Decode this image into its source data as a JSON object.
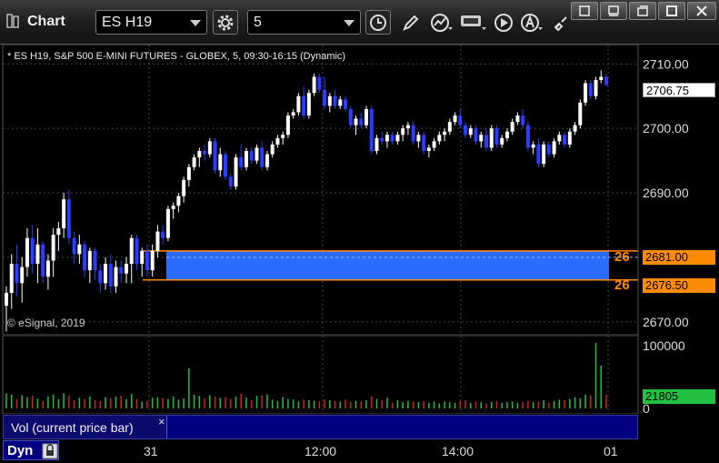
{
  "window": {
    "title": "Chart",
    "symbol": "ES H19",
    "interval": "5"
  },
  "chart": {
    "header": "* ES H19, S&P 500 E-MINI FUTURES - GLOBEX, 5, 09:30-16:15 (Dynamic)",
    "copyright": "© eSignal, 2019",
    "price_ticks": [
      "2710.00",
      "2700.00",
      "2690.00",
      "2680.00",
      "2670.00"
    ],
    "last_price": "2706.75",
    "zone_high": "2681.00",
    "zone_low": "2676.50",
    "zone_high_label": "26",
    "zone_low_label": "26",
    "zone_color": "#2b6cff",
    "line_color": "#ff8c00"
  },
  "volume": {
    "ticks": [
      "100000",
      "0"
    ],
    "last_volume": "21805",
    "study_label": "Vol (current price bar)",
    "close_symbol": "×"
  },
  "time_axis": {
    "labels": [
      "31",
      "12:00",
      "14:00",
      "01"
    ],
    "dyn_label": "Dyn"
  },
  "chart_data": [
    {
      "type": "candlestick",
      "title": "* ES H19, S&P 500 E-MINI FUTURES - GLOBEX, 5, 09:30-16:15 (Dynamic)",
      "ylim": [
        2668,
        2713
      ],
      "yticks": [
        2670,
        2680,
        2690,
        2700,
        2710
      ],
      "xticks": [
        "31",
        "12:00",
        "14:00",
        "01"
      ],
      "bars": [
        [
          2672.5,
          2675.5,
          2668.5,
          2674.5
        ],
        [
          2674.5,
          2680.5,
          2672.0,
          2679.0
        ],
        [
          2679.0,
          2682.0,
          2674.0,
          2676.0
        ],
        [
          2676.0,
          2680.0,
          2673.0,
          2678.5
        ],
        [
          2678.5,
          2684.5,
          2677.0,
          2683.0
        ],
        [
          2683.0,
          2685.0,
          2677.5,
          2679.0
        ],
        [
          2679.0,
          2684.5,
          2676.0,
          2682.0
        ],
        [
          2682.0,
          2682.5,
          2676.0,
          2677.0
        ],
        [
          2677.0,
          2680.5,
          2675.0,
          2679.5
        ],
        [
          2679.5,
          2684.5,
          2677.0,
          2683.5
        ],
        [
          2683.5,
          2685.5,
          2681.0,
          2684.5
        ],
        [
          2684.5,
          2690.0,
          2683.0,
          2689.0
        ],
        [
          2689.0,
          2690.5,
          2682.0,
          2683.0
        ],
        [
          2683.0,
          2684.0,
          2679.0,
          2680.5
        ],
        [
          2680.5,
          2683.5,
          2679.0,
          2682.0
        ],
        [
          2682.0,
          2682.5,
          2677.0,
          2678.0
        ],
        [
          2678.0,
          2681.5,
          2676.0,
          2681.0
        ],
        [
          2681.0,
          2681.5,
          2676.5,
          2678.0
        ],
        [
          2678.0,
          2679.0,
          2674.5,
          2676.0
        ],
        [
          2676.0,
          2680.0,
          2675.0,
          2679.0
        ],
        [
          2679.0,
          2680.5,
          2674.5,
          2675.5
        ],
        [
          2675.5,
          2679.5,
          2674.5,
          2678.5
        ],
        [
          2678.5,
          2679.5,
          2676.0,
          2677.5
        ],
        [
          2677.5,
          2680.0,
          2676.0,
          2679.0
        ],
        [
          2679.0,
          2683.5,
          2676.0,
          2683.0
        ],
        [
          2683.0,
          2683.5,
          2678.0,
          2679.0
        ],
        [
          2679.0,
          2681.5,
          2677.0,
          2681.0
        ],
        [
          2681.0,
          2682.0,
          2677.0,
          2678.0
        ],
        [
          2678.0,
          2682.0,
          2677.0,
          2681.0
        ],
        [
          2681.0,
          2685.0,
          2680.0,
          2684.0
        ],
        [
          2684.0,
          2685.0,
          2682.0,
          2683.0
        ],
        [
          2683.0,
          2688.0,
          2682.5,
          2687.5
        ],
        [
          2687.5,
          2688.5,
          2686.0,
          2688.0
        ],
        [
          2688.0,
          2690.0,
          2687.0,
          2689.5
        ],
        [
          2689.5,
          2692.5,
          2688.5,
          2692.0
        ],
        [
          2692.0,
          2694.5,
          2691.0,
          2694.0
        ],
        [
          2694.0,
          2696.0,
          2693.5,
          2695.5
        ],
        [
          2695.5,
          2697.0,
          2694.0,
          2696.5
        ],
        [
          2696.5,
          2697.5,
          2695.0,
          2696.0
        ],
        [
          2696.0,
          2698.5,
          2695.5,
          2698.0
        ],
        [
          2698.0,
          2698.5,
          2693.0,
          2693.5
        ],
        [
          2693.5,
          2697.0,
          2692.5,
          2696.0
        ],
        [
          2696.0,
          2696.5,
          2692.0,
          2692.5
        ],
        [
          2692.5,
          2693.0,
          2690.5,
          2691.0
        ],
        [
          2691.0,
          2696.0,
          2690.5,
          2695.5
        ],
        [
          2695.5,
          2697.5,
          2693.5,
          2694.0
        ],
        [
          2694.0,
          2697.0,
          2693.5,
          2696.5
        ],
        [
          2696.5,
          2697.0,
          2694.5,
          2695.0
        ],
        [
          2695.0,
          2697.5,
          2694.5,
          2697.0
        ],
        [
          2697.0,
          2698.0,
          2693.5,
          2694.0
        ],
        [
          2694.0,
          2696.5,
          2693.5,
          2696.0
        ],
        [
          2696.0,
          2698.0,
          2695.5,
          2697.5
        ],
        [
          2697.5,
          2699.0,
          2697.0,
          2698.5
        ],
        [
          2698.5,
          2699.5,
          2697.5,
          2699.0
        ],
        [
          2699.0,
          2702.5,
          2698.5,
          2702.0
        ],
        [
          2702.0,
          2703.0,
          2701.5,
          2702.5
        ],
        [
          2702.5,
          2705.5,
          2702.0,
          2705.0
        ],
        [
          2705.0,
          2706.5,
          2701.5,
          2702.0
        ],
        [
          2702.0,
          2706.0,
          2701.5,
          2705.5
        ],
        [
          2705.5,
          2708.5,
          2705.0,
          2708.0
        ],
        [
          2708.0,
          2708.5,
          2705.5,
          2706.0
        ],
        [
          2706.0,
          2708.0,
          2703.0,
          2703.5
        ],
        [
          2703.5,
          2705.5,
          2702.5,
          2705.0
        ],
        [
          2705.0,
          2706.0,
          2703.0,
          2703.5
        ],
        [
          2703.5,
          2705.0,
          2703.0,
          2704.5
        ],
        [
          2704.5,
          2705.0,
          2702.5,
          2703.0
        ],
        [
          2703.0,
          2703.5,
          2700.0,
          2700.5
        ],
        [
          2700.5,
          2702.0,
          2699.0,
          2701.5
        ],
        [
          2701.5,
          2702.5,
          2700.0,
          2700.5
        ],
        [
          2700.5,
          2703.5,
          2700.0,
          2703.0
        ],
        [
          2703.0,
          2703.5,
          2696.0,
          2696.5
        ],
        [
          2696.5,
          2699.0,
          2696.0,
          2698.5
        ],
        [
          2698.5,
          2699.5,
          2697.5,
          2698.0
        ],
        [
          2698.0,
          2699.5,
          2697.0,
          2699.0
        ],
        [
          2699.0,
          2699.5,
          2697.5,
          2698.0
        ],
        [
          2698.0,
          2699.5,
          2697.5,
          2699.0
        ],
        [
          2699.0,
          2700.5,
          2698.0,
          2700.0
        ],
        [
          2700.0,
          2701.0,
          2699.0,
          2700.5
        ],
        [
          2700.5,
          2701.0,
          2697.5,
          2698.0
        ],
        [
          2698.0,
          2699.5,
          2697.0,
          2699.0
        ],
        [
          2699.0,
          2699.5,
          2696.0,
          2696.5
        ],
        [
          2696.5,
          2697.5,
          2695.5,
          2697.0
        ],
        [
          2697.0,
          2698.5,
          2696.5,
          2698.0
        ],
        [
          2698.0,
          2699.5,
          2697.5,
          2699.0
        ],
        [
          2699.0,
          2700.0,
          2698.0,
          2699.5
        ],
        [
          2699.5,
          2701.5,
          2699.0,
          2701.0
        ],
        [
          2701.0,
          2702.5,
          2700.5,
          2702.0
        ],
        [
          2702.0,
          2703.0,
          2700.0,
          2700.5
        ],
        [
          2700.5,
          2701.0,
          2698.5,
          2699.0
        ],
        [
          2699.0,
          2700.5,
          2698.5,
          2700.0
        ],
        [
          2700.0,
          2700.5,
          2697.5,
          2698.0
        ],
        [
          2698.0,
          2699.5,
          2697.0,
          2699.0
        ],
        [
          2699.0,
          2700.0,
          2696.5,
          2697.0
        ],
        [
          2697.0,
          2700.5,
          2696.5,
          2700.0
        ],
        [
          2700.0,
          2700.5,
          2697.0,
          2697.5
        ],
        [
          2697.5,
          2699.0,
          2697.0,
          2698.5
        ],
        [
          2698.5,
          2700.0,
          2698.0,
          2699.5
        ],
        [
          2699.5,
          2701.5,
          2699.0,
          2701.0
        ],
        [
          2701.0,
          2702.5,
          2700.5,
          2702.0
        ],
        [
          2702.0,
          2703.0,
          2700.0,
          2700.5
        ],
        [
          2700.5,
          2701.0,
          2696.5,
          2697.0
        ],
        [
          2697.0,
          2698.0,
          2696.0,
          2697.5
        ],
        [
          2697.5,
          2698.5,
          2694.0,
          2694.5
        ],
        [
          2694.5,
          2698.0,
          2694.0,
          2697.5
        ],
        [
          2697.5,
          2698.0,
          2695.5,
          2696.0
        ],
        [
          2696.0,
          2698.5,
          2695.5,
          2698.0
        ],
        [
          2698.0,
          2699.5,
          2697.5,
          2699.0
        ],
        [
          2699.0,
          2699.5,
          2697.0,
          2697.5
        ],
        [
          2697.5,
          2700.0,
          2697.0,
          2699.5
        ],
        [
          2699.5,
          2701.0,
          2699.0,
          2700.5
        ],
        [
          2700.5,
          2704.5,
          2700.0,
          2704.0
        ],
        [
          2704.0,
          2707.5,
          2703.5,
          2707.0
        ],
        [
          2707.0,
          2707.5,
          2704.5,
          2705.0
        ],
        [
          2705.0,
          2708.0,
          2704.5,
          2707.5
        ],
        [
          2707.5,
          2709.0,
          2707.0,
          2708.0
        ],
        [
          2708.0,
          2708.5,
          2706.5,
          2706.75
        ]
      ]
    },
    {
      "type": "bar",
      "title": "Vol (current price bar)",
      "ylim": [
        0,
        110000
      ],
      "yticks": [
        0,
        100000
      ],
      "last_value": 21805,
      "values": [
        24000,
        22000,
        15000,
        21000,
        18000,
        20000,
        16000,
        12000,
        19000,
        22000,
        15000,
        24000,
        20000,
        13000,
        17000,
        15000,
        19000,
        13000,
        12000,
        18000,
        16000,
        19000,
        20000,
        15000,
        23000,
        15000,
        11000,
        12000,
        17000,
        18000,
        17000,
        15000,
        19000,
        14000,
        16000,
        64000,
        22000,
        20000,
        16000,
        21000,
        19000,
        17000,
        18000,
        15000,
        19000,
        23000,
        17000,
        13000,
        20000,
        21000,
        22000,
        14000,
        12000,
        18000,
        15000,
        14000,
        11000,
        14000,
        13000,
        12000,
        11000,
        14000,
        13000,
        12000,
        11000,
        14000,
        10000,
        12000,
        11000,
        13000,
        19000,
        15000,
        13000,
        17000,
        9000,
        13000,
        10000,
        12000,
        11000,
        10000,
        12000,
        9000,
        11000,
        8000,
        11000,
        10000,
        9000,
        12000,
        13000,
        9000,
        11000,
        10000,
        8000,
        10000,
        12000,
        9000,
        10000,
        11000,
        9000,
        10000,
        12000,
        10000,
        11000,
        13000,
        9000,
        12000,
        14000,
        13000,
        15000,
        18000,
        16000,
        22000,
        21000,
        104000,
        68000,
        21805
      ]
    }
  ]
}
